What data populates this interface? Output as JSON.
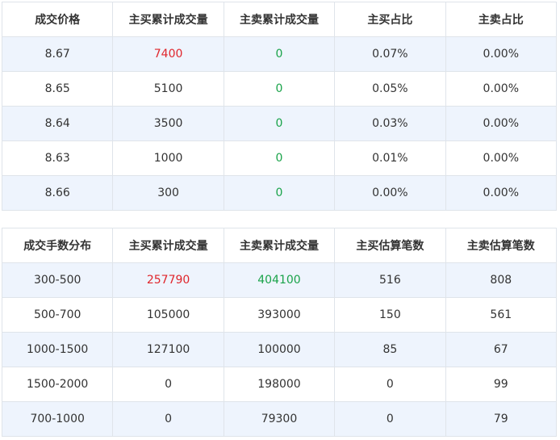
{
  "colors": {
    "red": "#e0262c",
    "green": "#1aa34a",
    "stripe": "#eef4fd",
    "border": "#dfe4ea"
  },
  "price_table": {
    "headers": [
      "成交价格",
      "主买累计成交量",
      "主卖累计成交量",
      "主买占比",
      "主卖占比"
    ],
    "rows": [
      [
        "8.67",
        "7400",
        "0",
        "0.07%",
        "0.00%"
      ],
      [
        "8.65",
        "5100",
        "0",
        "0.05%",
        "0.00%"
      ],
      [
        "8.64",
        "3500",
        "0",
        "0.03%",
        "0.00%"
      ],
      [
        "8.63",
        "1000",
        "0",
        "0.01%",
        "0.00%"
      ],
      [
        "8.66",
        "300",
        "0",
        "0.00%",
        "0.00%"
      ]
    ]
  },
  "lots_table": {
    "headers": [
      "成交手数分布",
      "主买累计成交量",
      "主卖累计成交量",
      "主买估算笔数",
      "主卖估算笔数"
    ],
    "rows": [
      [
        "300-500",
        "257790",
        "404100",
        "516",
        "808"
      ],
      [
        "500-700",
        "105000",
        "393000",
        "150",
        "561"
      ],
      [
        "1000-1500",
        "127100",
        "100000",
        "85",
        "67"
      ],
      [
        "1500-2000",
        "0",
        "198000",
        "0",
        "99"
      ],
      [
        "700-1000",
        "0",
        "79300",
        "0",
        "79"
      ]
    ]
  }
}
